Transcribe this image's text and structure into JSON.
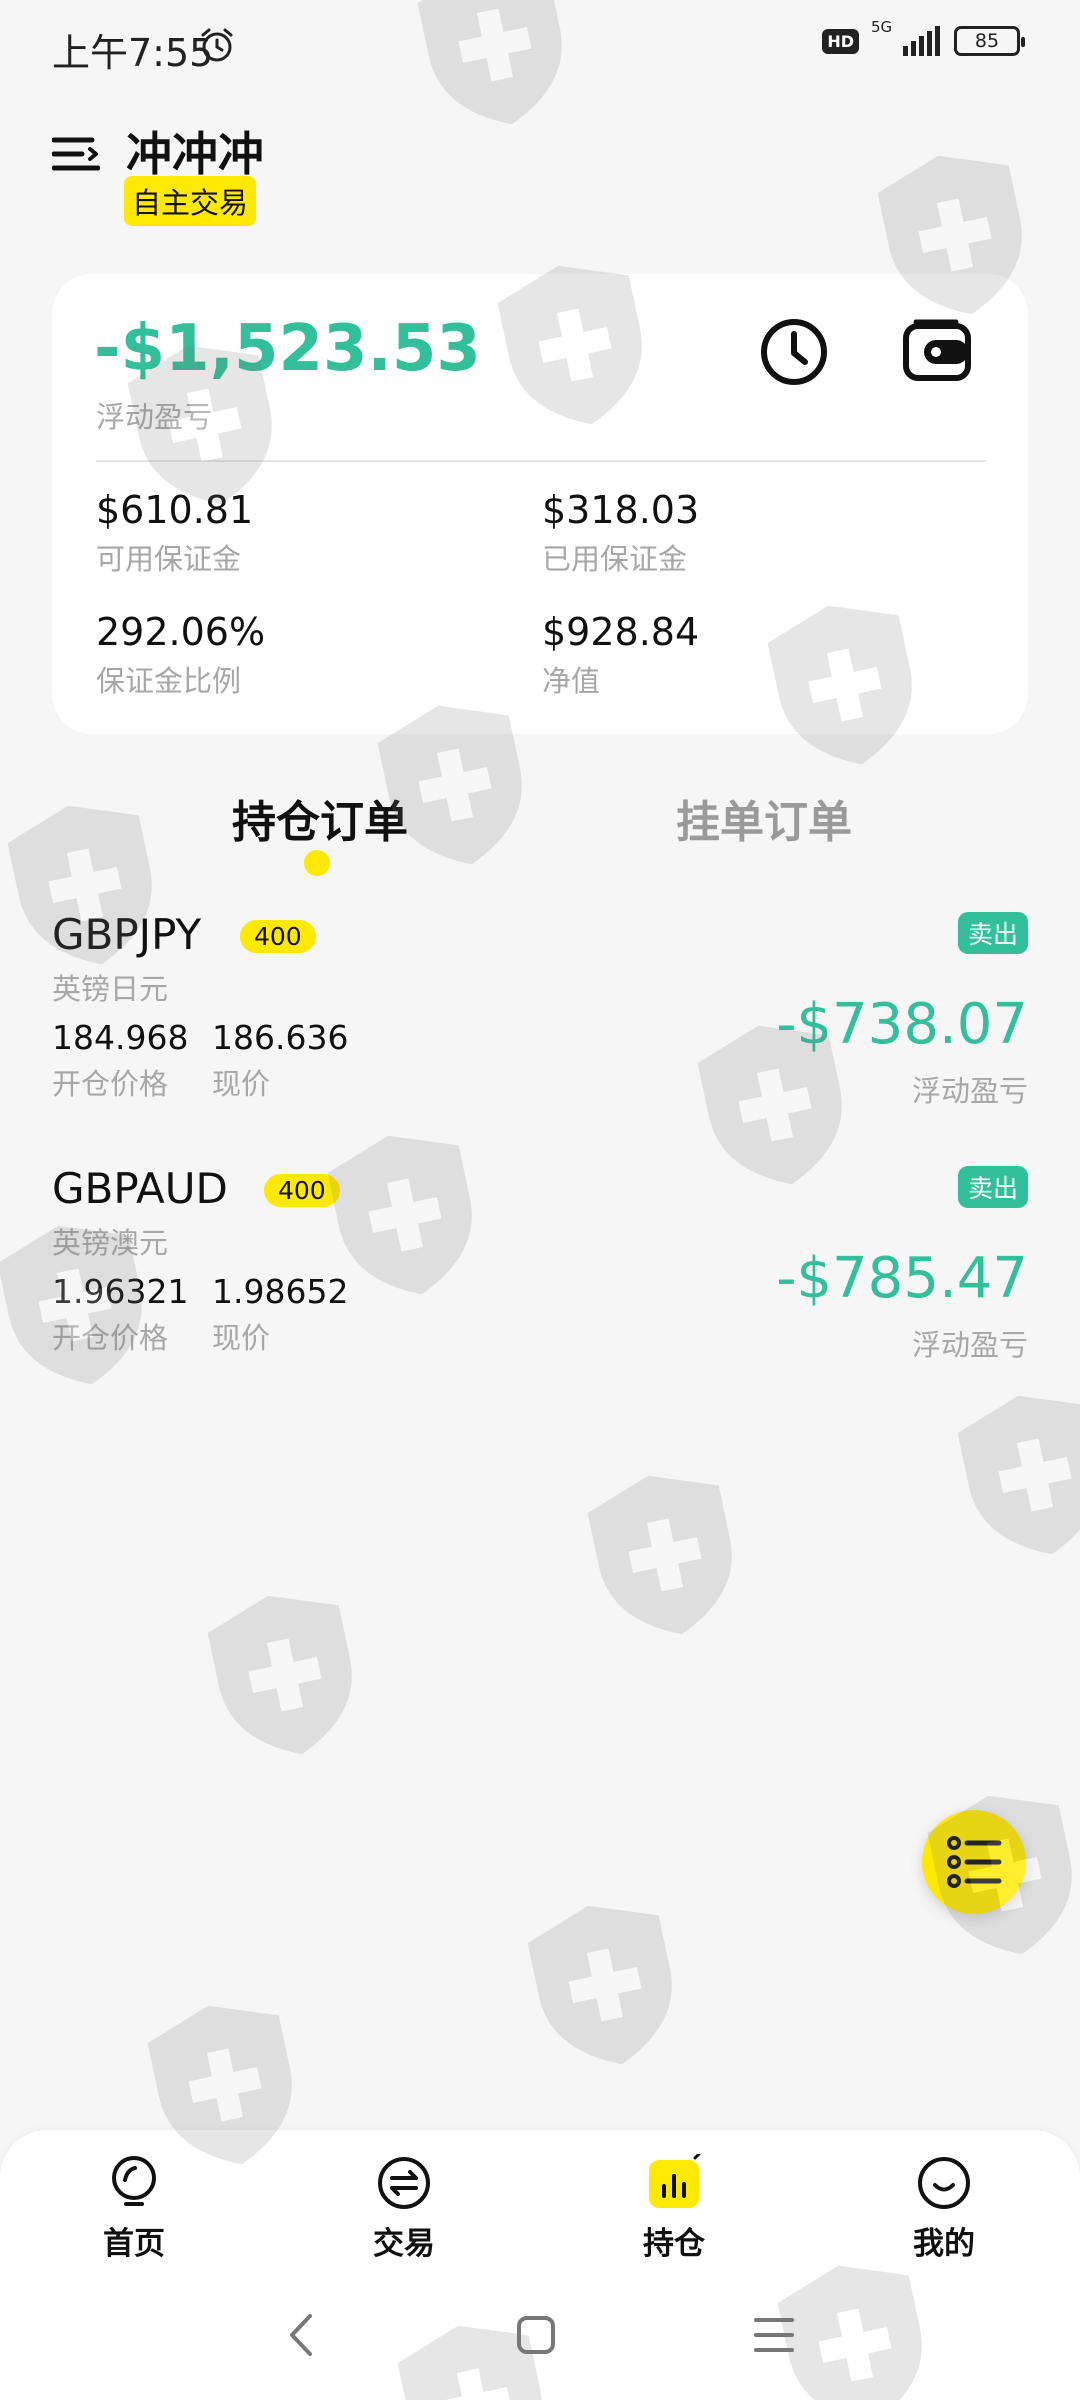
{
  "status_bar": {
    "time": "上午7:55",
    "hd": "HD",
    "network": "5G",
    "battery": "85"
  },
  "header": {
    "title": "冲冲冲",
    "mode_badge": "自主交易"
  },
  "account": {
    "floating_pl": "-$1,523.53",
    "floating_pl_label": "浮动盈亏",
    "metrics": [
      {
        "value": "$610.81",
        "label": "可用保证金"
      },
      {
        "value": "$318.03",
        "label": "已用保证金"
      },
      {
        "value": "292.06%",
        "label": "保证金比例"
      },
      {
        "value": "$928.84",
        "label": "净值"
      }
    ]
  },
  "tabs": [
    {
      "label": "持仓订单",
      "active": true
    },
    {
      "label": "挂单订单",
      "active": false
    }
  ],
  "positions": [
    {
      "symbol": "GBPJPY",
      "lot": "400",
      "name": "英镑日元",
      "open_price": "184.968",
      "open_label": "开仓价格",
      "current_price": "186.636",
      "current_label": "现价",
      "side": "卖出",
      "pl": "-$738.07",
      "pl_label": "浮动盈亏"
    },
    {
      "symbol": "GBPAUD",
      "lot": "400",
      "name": "英镑澳元",
      "open_price": "1.96321",
      "open_label": "开仓价格",
      "current_price": "1.98652",
      "current_label": "现价",
      "side": "卖出",
      "pl": "-$785.47",
      "pl_label": "浮动盈亏"
    }
  ],
  "bottom_nav": [
    {
      "label": "首页",
      "icon": "bulb-icon"
    },
    {
      "label": "交易",
      "icon": "exchange-icon"
    },
    {
      "label": "持仓",
      "icon": "positions-chart-icon",
      "active": true
    },
    {
      "label": "我的",
      "icon": "profile-smile-icon"
    }
  ],
  "colors": {
    "accent_yellow": "#ffe900",
    "profit_green": "#31c09a",
    "muted_gray": "#a7a7a7",
    "background": "#f6f6f6"
  }
}
